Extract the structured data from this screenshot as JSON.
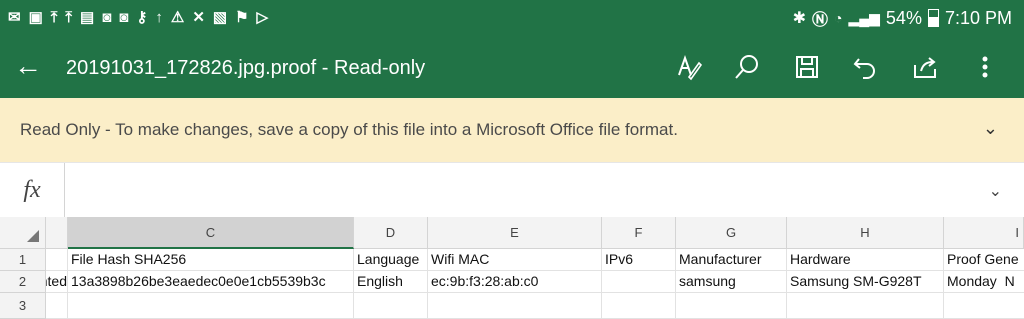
{
  "status_bar": {
    "notification_icons": [
      "mail-icon",
      "gallery-mail-icon",
      "upload-icon",
      "upload-icon",
      "image-icon",
      "app-icon",
      "app-icon",
      "key-icon",
      "data-icon",
      "warning-icon",
      "missed-mail-icon",
      "app-icon",
      "flag-icon",
      "play-icon"
    ],
    "battery": "54%",
    "time": "7:10 PM"
  },
  "app_bar": {
    "title": "20191031_172826.jpg.proof - Read-only",
    "tools": [
      "draw-icon",
      "search-icon",
      "save-icon",
      "undo-icon",
      "share-icon",
      "more-icon"
    ]
  },
  "banner": {
    "text": "Read Only - To make changes, save a copy of this file into a Microsoft Office file format."
  },
  "formula_bar": {
    "fx": "fx",
    "value": ""
  },
  "sheet": {
    "columns": [
      "C",
      "D",
      "E",
      "F",
      "G",
      "H",
      "I"
    ],
    "rows": [
      "1",
      "2",
      "3"
    ],
    "row1": {
      "C": "File Hash SHA256",
      "D": "Language",
      "E": "Wifi MAC",
      "F": "IPv6",
      "G": "Manufacturer",
      "H": "Hardware",
      "I": "Proof Gene"
    },
    "row2": {
      "B": "nted",
      "C": "13a3898b26be3eaedec0e0e1cb5539b3c",
      "D": "English",
      "E": "ec:9b:f3:28:ab:c0",
      "F": "",
      "G": "samsung",
      "H": "Samsung SM-G928T",
      "I": "Monday  N"
    }
  },
  "colors": {
    "brand": "#217346",
    "banner": "#fbeec8"
  }
}
